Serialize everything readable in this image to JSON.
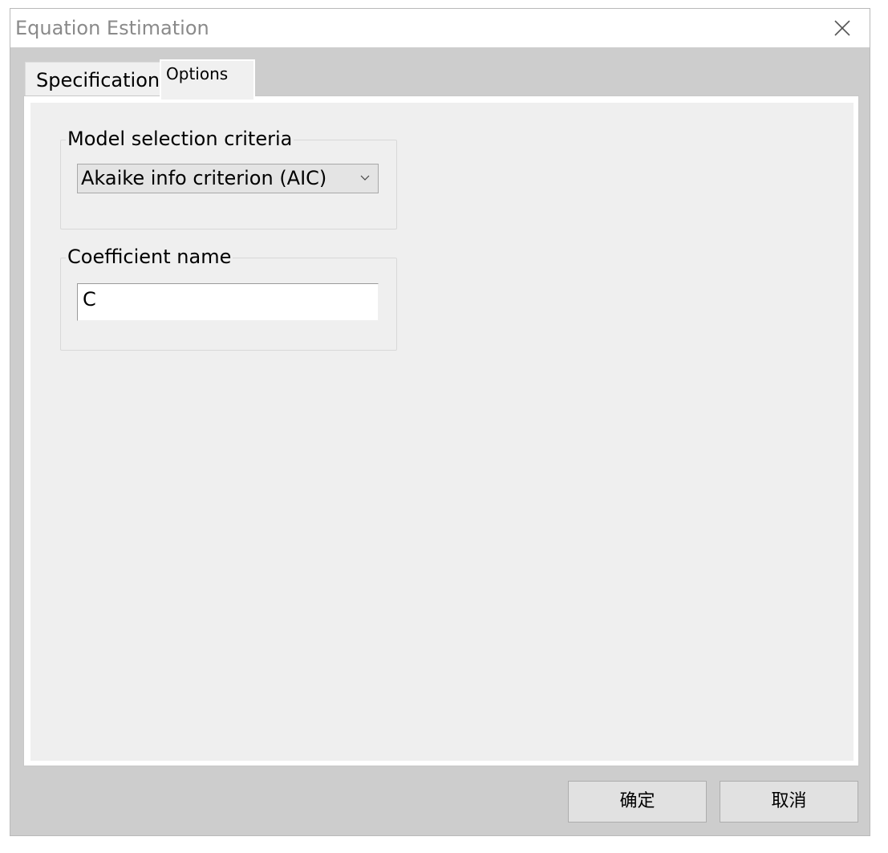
{
  "window": {
    "title": "Equation Estimation"
  },
  "tabs": [
    {
      "label": "Specification",
      "selected": false
    },
    {
      "label": "Options",
      "selected": true
    }
  ],
  "options": {
    "model_selection": {
      "label": "Model selection criteria",
      "selected": "Akaike info criterion (AIC)"
    },
    "coefficient": {
      "label": "Coefficient name",
      "value": "C"
    }
  },
  "buttons": {
    "ok_label": "确定",
    "cancel_label": "取消"
  },
  "icons": {
    "close": "close-icon",
    "dropdown": "chevron-down-icon"
  },
  "colors": {
    "dialog_background": "#cdcdcd",
    "panel_background": "#efefef",
    "title_text": "#8a8a8a"
  }
}
